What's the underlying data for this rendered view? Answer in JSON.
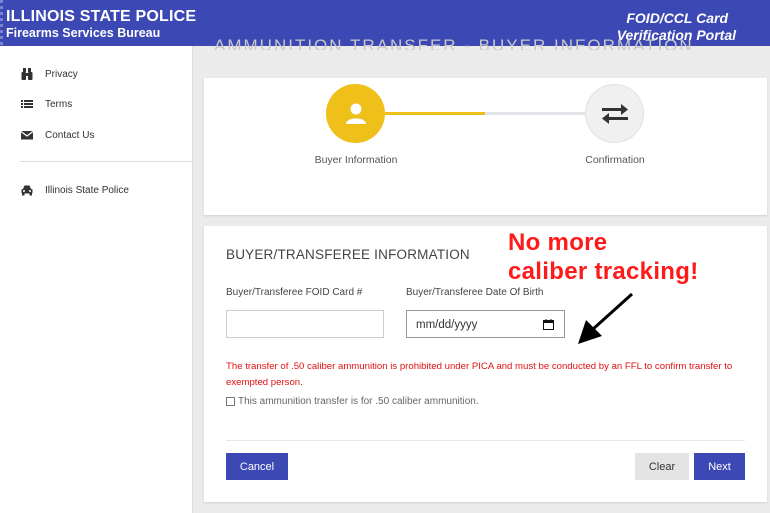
{
  "header": {
    "agency": "ILLINOIS STATE POLICE",
    "bureau": "Firearms Services Bureau",
    "portal_line1": "FOID/CCL Card",
    "portal_line2": "Verification Portal"
  },
  "sidebar": {
    "items": [
      {
        "label": "Privacy",
        "icon": "binoculars-icon"
      },
      {
        "label": "Terms",
        "icon": "list-icon"
      },
      {
        "label": "Contact Us",
        "icon": "envelope-icon"
      },
      {
        "label": "Illinois State Police",
        "icon": "car-icon"
      }
    ]
  },
  "page": {
    "bg_title": "AMMUNITION TRANSFER - BUYER INFORMATION"
  },
  "stepper": {
    "steps": [
      {
        "label": "Buyer Information",
        "state": "active",
        "icon": "user-icon"
      },
      {
        "label": "Confirmation",
        "state": "pending",
        "icon": "exchange-icon"
      }
    ],
    "colors": {
      "active": "#f0c01a",
      "pending": "#f0f0f0"
    }
  },
  "form": {
    "title": "BUYER/TRANSFEREE INFORMATION",
    "foid_label": "Buyer/Transferee FOID Card #",
    "foid_value": "",
    "dob_label": "Buyer/Transferee Date Of Birth",
    "dob_placeholder": "mm/dd/yyyy",
    "warning": "The transfer of .50 caliber ammunition is prohibited under PICA and must be conducted by an FFL to confirm transfer to exempted person.",
    "checkbox_label": "This ammunition transfer is for .50 caliber ammunition.",
    "checkbox_checked": false
  },
  "actions": {
    "cancel": "Cancel",
    "clear": "Clear",
    "next": "Next"
  },
  "annotation": {
    "line1": "No more",
    "line2": "caliber tracking!",
    "color": "#ff1a1a"
  },
  "colors": {
    "primary": "#3c48b4",
    "accent": "#f0c01a",
    "error": "#e01010"
  }
}
